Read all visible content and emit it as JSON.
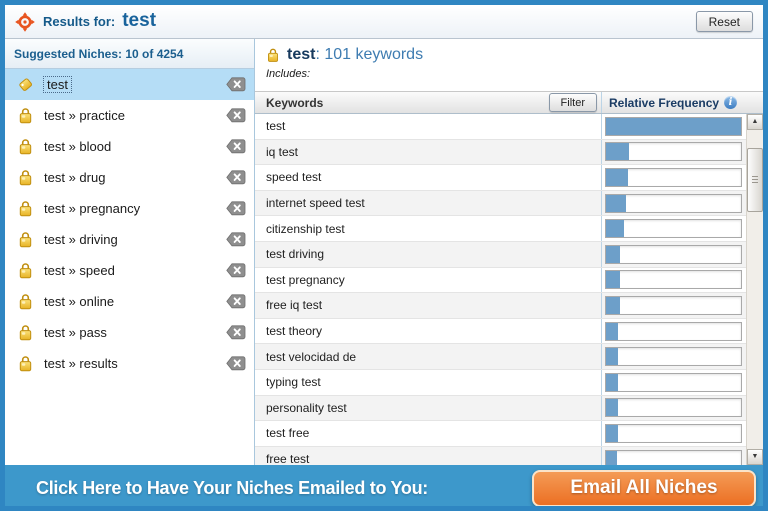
{
  "colors": {
    "frame_blue": "#2f86c2",
    "footer_blue": "#3d98cb",
    "accent_orange": "#ee7428",
    "bar_fill": "#6d9fc9",
    "selected_item_bg": "#b5ddf6"
  },
  "titlebar": {
    "title_label": "Results for:",
    "query": "test",
    "reset_button": "Reset"
  },
  "sidebar": {
    "header": "Suggested Niches: 10 of 4254",
    "items": [
      {
        "label": "test",
        "selected": true
      },
      {
        "label": "test » practice",
        "selected": false
      },
      {
        "label": "test » blood",
        "selected": false
      },
      {
        "label": "test » drug",
        "selected": false
      },
      {
        "label": "test » pregnancy",
        "selected": false
      },
      {
        "label": "test » driving",
        "selected": false
      },
      {
        "label": "test » speed",
        "selected": false
      },
      {
        "label": "test » online",
        "selected": false
      },
      {
        "label": "test » pass",
        "selected": false
      },
      {
        "label": "test » results",
        "selected": false
      }
    ]
  },
  "main": {
    "selected_niche": "test",
    "keyword_count_suffix": ": 101 keywords",
    "includes_label": "Includes:",
    "table": {
      "keywords_header": "Keywords",
      "filter_button": "Filter",
      "frequency_header": "Relative Frequency",
      "rows": [
        {
          "keyword": "test",
          "frequency_pct": 100
        },
        {
          "keyword": "iq test",
          "frequency_pct": 17
        },
        {
          "keyword": "speed test",
          "frequency_pct": 16
        },
        {
          "keyword": "internet speed test",
          "frequency_pct": 15
        },
        {
          "keyword": "citizenship test",
          "frequency_pct": 13
        },
        {
          "keyword": "test driving",
          "frequency_pct": 10
        },
        {
          "keyword": "test pregnancy",
          "frequency_pct": 10
        },
        {
          "keyword": "free iq test",
          "frequency_pct": 10
        },
        {
          "keyword": "test theory",
          "frequency_pct": 9
        },
        {
          "keyword": "test velocidad de",
          "frequency_pct": 9
        },
        {
          "keyword": "typing test",
          "frequency_pct": 9
        },
        {
          "keyword": "personality test",
          "frequency_pct": 9
        },
        {
          "keyword": "test free",
          "frequency_pct": 9
        },
        {
          "keyword": "free test",
          "frequency_pct": 8
        }
      ]
    }
  },
  "footer": {
    "message": "Click Here to Have Your Niches Emailed to You:",
    "button_label": "Email All Niches"
  }
}
